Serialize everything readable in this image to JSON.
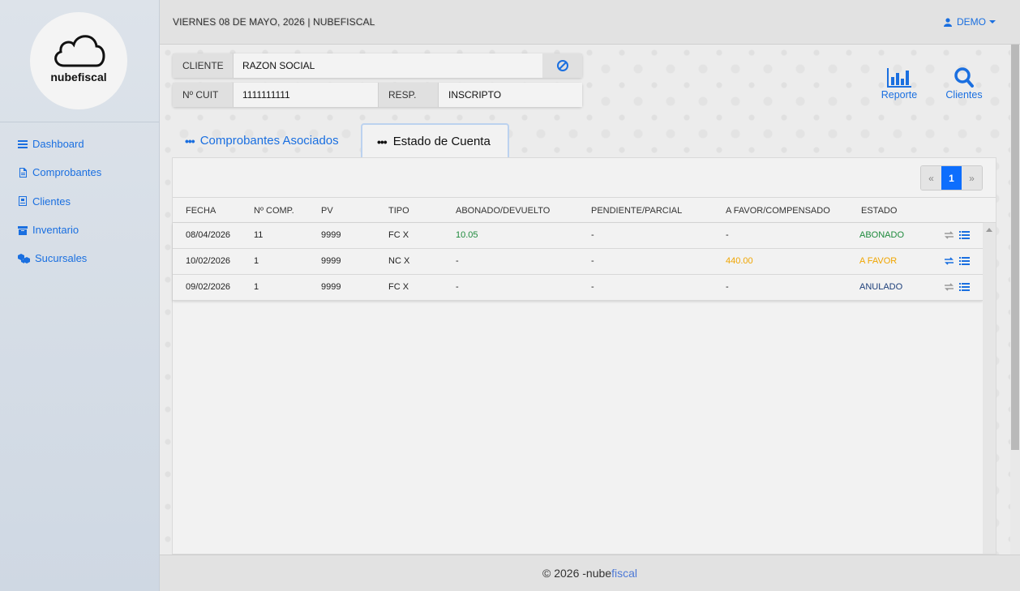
{
  "brand": {
    "logo_text": "nubefiscal"
  },
  "sidebar": {
    "items": [
      {
        "label": "Dashboard",
        "icon": "bars-icon"
      },
      {
        "label": "Comprobantes",
        "icon": "file-icon"
      },
      {
        "label": "Clientes",
        "icon": "id-card-icon"
      },
      {
        "label": "Inventario",
        "icon": "box-icon"
      },
      {
        "label": "Sucursales",
        "icon": "cubes-icon"
      }
    ]
  },
  "header": {
    "date_text": "VIERNES 08 DE MAYO, 2026 | NUBEFISCAL",
    "user_label": "DEMO"
  },
  "client": {
    "cliente_label": "CLIENTE",
    "cliente_value": "RAZON SOCIAL",
    "cuit_label": "Nº CUIT",
    "cuit_value": "1111111111",
    "resp_label": "RESP.",
    "resp_value": "INSCRIPTO"
  },
  "tools": {
    "reporte_label": "Reporte",
    "clientes_label": "Clientes"
  },
  "tabs": {
    "asociados": "Comprobantes Asociados",
    "estado": "Estado de Cuenta"
  },
  "pager": {
    "prev": "«",
    "current": "1",
    "next": "»"
  },
  "table": {
    "headers": [
      "FECHA",
      "Nº COMP.",
      "PV",
      "TIPO",
      "ABONADO/DEVUELTO",
      "PENDIENTE/PARCIAL",
      "A FAVOR/COMPENSADO",
      "ESTADO"
    ],
    "rows": [
      {
        "fecha": "08/04/2026",
        "comp": "11",
        "pv": "9999",
        "tipo": "FC X",
        "abonado": "10.05",
        "pendiente": "-",
        "favor": "-",
        "estado": "ABONADO"
      },
      {
        "fecha": "10/02/2026",
        "comp": "1",
        "pv": "9999",
        "tipo": "NC X",
        "abonado": "-",
        "pendiente": "-",
        "favor": "440.00",
        "estado": "A FAVOR"
      },
      {
        "fecha": "09/02/2026",
        "comp": "1",
        "pv": "9999",
        "tipo": "FC X",
        "abonado": "-",
        "pendiente": "-",
        "favor": "-",
        "estado": "ANULADO"
      }
    ]
  },
  "footer": {
    "copyright": "© 2026 - ",
    "brand_part1": "nube",
    "brand_part2": "fiscal"
  },
  "colors": {
    "accent": "#1a6fe0",
    "abonado": "#1e8a3c",
    "favor": "#f0a500",
    "anulado": "#1d3f7a"
  }
}
